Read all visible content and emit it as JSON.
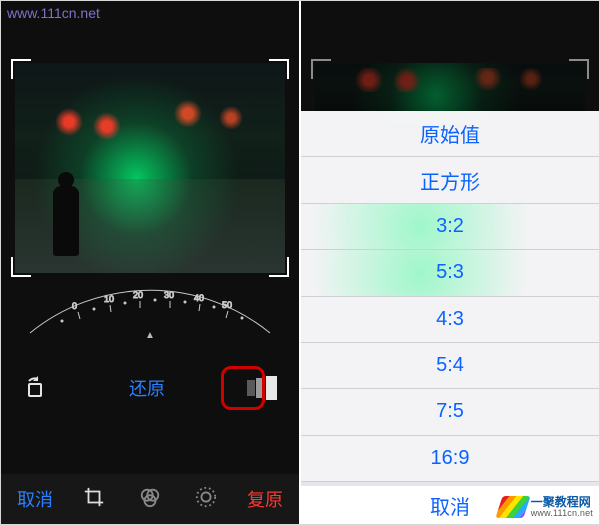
{
  "watermark": {
    "url_text": "www.111cn.net"
  },
  "site_logo": {
    "title": "一聚教程网",
    "subtitle": "www.111cn.net"
  },
  "left": {
    "dial": {
      "ticks": [
        "0",
        "10",
        "20",
        "30",
        "40",
        "50"
      ]
    },
    "mid": {
      "revert_label": "还原"
    },
    "bottom": {
      "cancel": "取消",
      "reset": "复原"
    }
  },
  "right": {
    "aspect_options": [
      {
        "label": "原始值"
      },
      {
        "label": "正方形"
      },
      {
        "label": "3:2"
      },
      {
        "label": "5:3"
      },
      {
        "label": "4:3"
      },
      {
        "label": "5:4"
      },
      {
        "label": "7:5"
      },
      {
        "label": "16:9"
      }
    ],
    "cancel": "取消"
  }
}
